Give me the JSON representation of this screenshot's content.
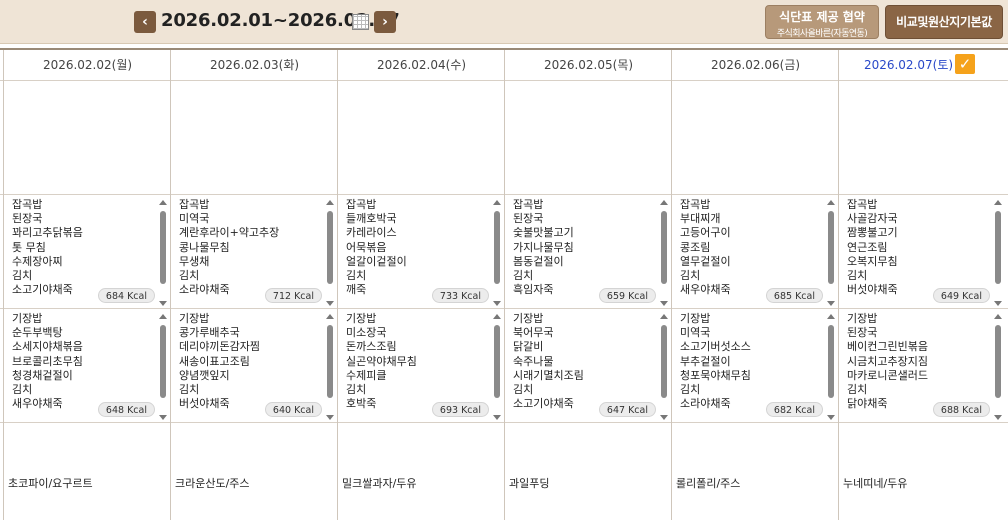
{
  "header": {
    "prev_label": "‹",
    "next_label": "›",
    "date_range": "2026.02.01~2026.02.07",
    "btn_menu_title": "식단표 제공 협약",
    "btn_menu_sub": "주식회사올바른(자동연동)",
    "btn_compare": "비교및원산지기본값"
  },
  "days": [
    {
      "date": "2026.02.02(월)",
      "lunch": {
        "items": [
          "잡곡밥",
          "된장국",
          "꽈리고추닭볶음",
          "톳 무침",
          "수제장아찌",
          "김치",
          "소고기야채죽"
        ],
        "kcal": "684 Kcal"
      },
      "dinner": {
        "items": [
          "기장밥",
          "순두부백탕",
          "소세지야채볶음",
          "브로콜리초무침",
          "청경채겉절이",
          "김치",
          "새우야채죽"
        ],
        "kcal": "648 Kcal"
      },
      "snack": "초코파이/요구르트"
    },
    {
      "date": "2026.02.03(화)",
      "lunch": {
        "items": [
          "잡곡밥",
          "미역국",
          "계란후라이+약고추장",
          "콩나물무침",
          "무생채",
          "김치",
          "소라야채죽"
        ],
        "kcal": "712 Kcal"
      },
      "dinner": {
        "items": [
          "기장밥",
          "콩가루배추국",
          "데리야끼돈감자찜",
          "새송이표고조림",
          "양념깻잎지",
          "김치",
          "버섯야채죽"
        ],
        "kcal": "640 Kcal"
      },
      "snack": "크라운산도/주스"
    },
    {
      "date": "2026.02.04(수)",
      "lunch": {
        "items": [
          "잡곡밥",
          "들깨호박국",
          "카레라이스",
          "어묵볶음",
          "얼갈이겉절이",
          "김치",
          "깨죽"
        ],
        "kcal": "733 Kcal"
      },
      "dinner": {
        "items": [
          "기장밥",
          "미소장국",
          "돈까스조림",
          "실곤약야채무침",
          "수제피클",
          "김치",
          "호박죽"
        ],
        "kcal": "693 Kcal"
      },
      "snack": "밀크쌀과자/두유"
    },
    {
      "date": "2026.02.05(목)",
      "lunch": {
        "items": [
          "잡곡밥",
          "된장국",
          "숯불맛불고기",
          "가지나물무침",
          "봄동겉절이",
          "김치",
          "흑임자죽"
        ],
        "kcal": "659 Kcal"
      },
      "dinner": {
        "items": [
          "기장밥",
          "북어무국",
          "닭갈비",
          "숙주나물",
          "시래기멸치조림",
          "김치",
          "소고기야채죽"
        ],
        "kcal": "647 Kcal"
      },
      "snack": "과일푸딩"
    },
    {
      "date": "2026.02.06(금)",
      "lunch": {
        "items": [
          "잡곡밥",
          "부대찌개",
          "고등어구이",
          "콩조림",
          "열무겉절이",
          "김치",
          "새우야채죽"
        ],
        "kcal": "685 Kcal"
      },
      "dinner": {
        "items": [
          "기장밥",
          "미역국",
          "소고기버섯소스",
          "부추겉절이",
          "청포묵야채무침",
          "김치",
          "소라야채죽"
        ],
        "kcal": "682 Kcal"
      },
      "snack": "롤리폴리/주스"
    },
    {
      "date": "2026.02.07(토)",
      "lunch": {
        "items": [
          "잡곡밥",
          "사골감자국",
          "짬뽕불고기",
          "연근조림",
          "오복지무침",
          "김치",
          "버섯야채죽"
        ],
        "kcal": "649 Kcal"
      },
      "dinner": {
        "items": [
          "기장밥",
          "된장국",
          "베이컨그린빈볶음",
          "시금치고추장지짐",
          "마카로니콘샐러드",
          "김치",
          "닭야채죽"
        ],
        "kcal": "688 Kcal"
      },
      "snack": "누네띠네/두유"
    }
  ],
  "colors": {
    "accent_brown": "#8a6545",
    "saturday_blue": "#2a49c8",
    "check_orange": "#f5a21b"
  },
  "icons": {
    "calendar": "calendar-icon",
    "check": "checkbox-checked-icon"
  }
}
